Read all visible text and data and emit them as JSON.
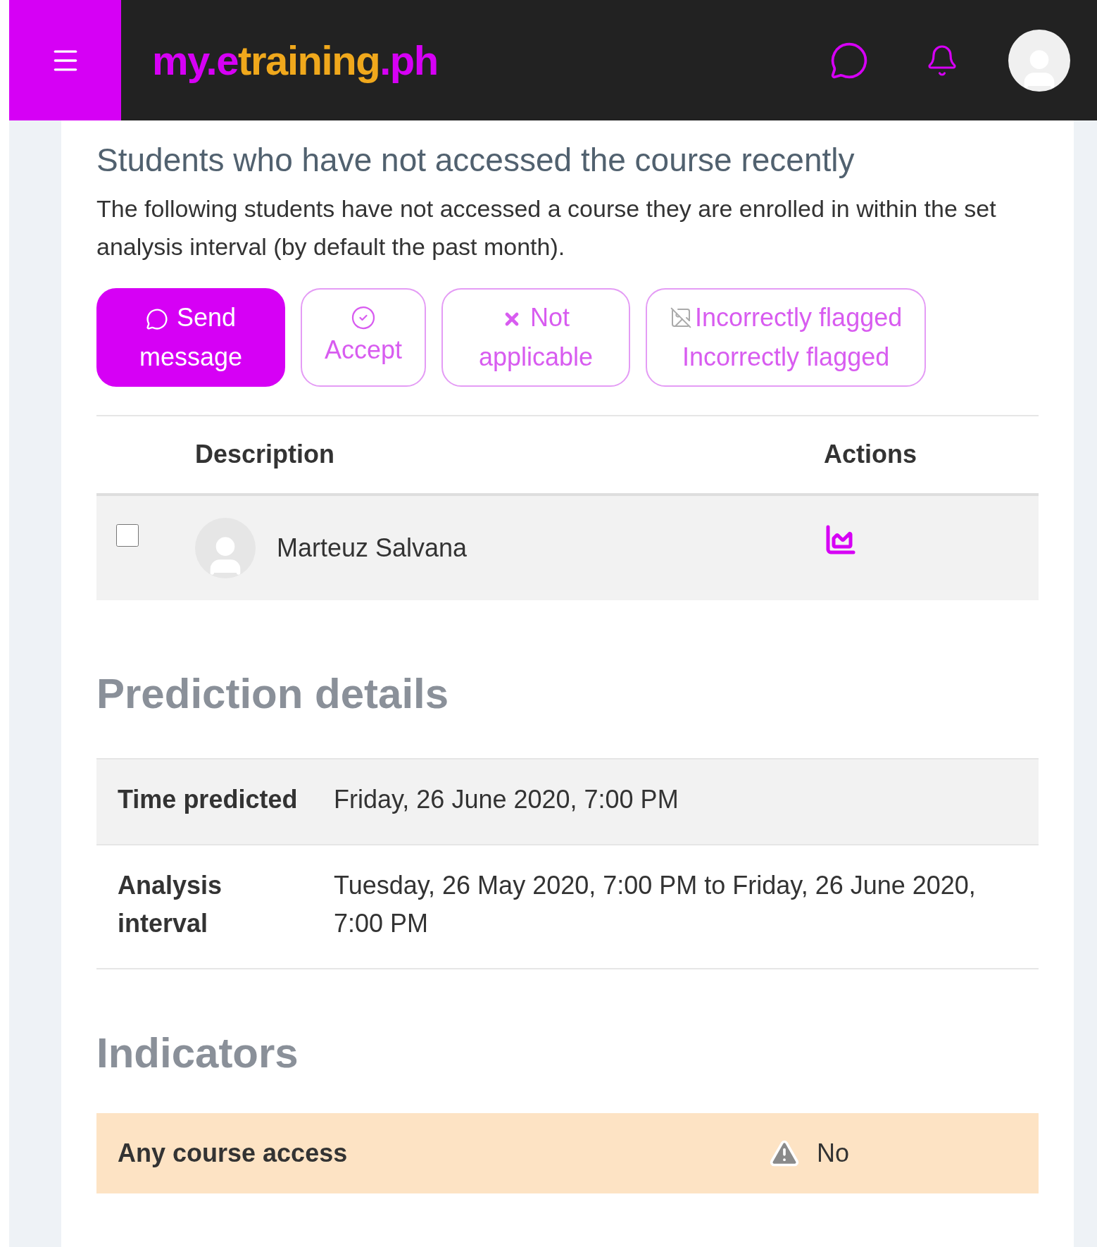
{
  "header": {
    "logo": [
      {
        "text": "my.e",
        "color": "#d600f5"
      },
      {
        "text": "training",
        "color": "#f0a81c"
      },
      {
        "text": ".ph",
        "color": "#d600f5"
      }
    ]
  },
  "section": {
    "title": "Students who have not accessed the course recently",
    "description": "The following students have not accessed a course they are enrolled in within the set analysis interval (by default the past month)."
  },
  "actions": [
    {
      "kind": "message",
      "label": "Send message"
    },
    {
      "kind": "accept",
      "label": "Accept"
    },
    {
      "kind": "dismiss",
      "label": "Not applicable"
    },
    {
      "kind": "flag",
      "image_alt": "Incorrectly flagged",
      "label": "Incorrectly flagged"
    }
  ],
  "table": {
    "columns": [
      "Description",
      "Actions"
    ],
    "rows": [
      {
        "checked": false,
        "name": "Marteuz Salvana"
      }
    ]
  },
  "prediction_details": {
    "title": "Prediction details",
    "rows": [
      {
        "label": "Time predicted",
        "value": "Friday, 26 June 2020, 7:00 PM"
      },
      {
        "label": "Analysis interval",
        "value": "Tuesday, 26 May 2020, 7:00 PM to Friday, 26 June 2020, 7:00 PM"
      }
    ]
  },
  "indicators": {
    "title": "Indicators",
    "rows": [
      {
        "label": "Any course access",
        "value": "No",
        "kind": "warning"
      }
    ]
  }
}
